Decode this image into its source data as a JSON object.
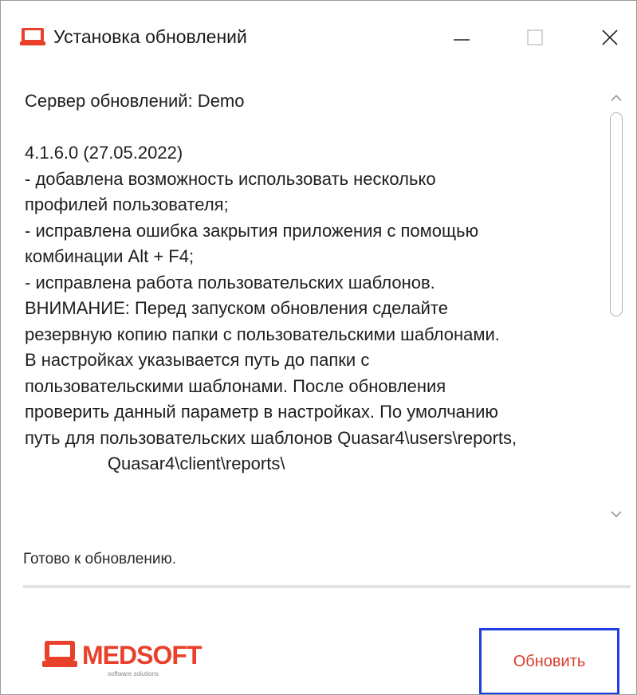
{
  "window": {
    "title": "Установка обновлений",
    "icon": "medsoft-logo-icon",
    "controls": [
      "minimize-icon",
      "maximize-icon",
      "close-icon"
    ]
  },
  "notes": {
    "lines": [
      "Сервер обновлений: Demo",
      "",
      "4.1.6.0 (27.05.2022)",
      "- добавлена возможность использовать несколько",
      "профилей пользователя;",
      "- исправлена ошибка закрытия приложения с помощью",
      "комбинации Alt + F4;",
      "- исправлена работа пользовательских шаблонов.",
      "ВНИМАНИЕ: Перед запуском обновления сделайте",
      "резервную копию папки с пользовательскими шаблонами.",
      "В настройках указывается путь до папки с",
      "пользовательскими шаблонами. После обновления",
      "проверить данный параметр в настройках. По умолчанию",
      "путь для пользовательских шаблонов Quasar4\\users\\reports,",
      "                 Quasar4\\client\\reports\\"
    ]
  },
  "status": {
    "text": "Готово к обновлению."
  },
  "logo": {
    "brand": "MEDSOFT",
    "tagline": "software solutions",
    "color": "#e8402b"
  },
  "actions": {
    "update_label": "Обновить"
  },
  "colors": {
    "accent": "#e8402b",
    "focus_border": "#1f3fe0"
  }
}
